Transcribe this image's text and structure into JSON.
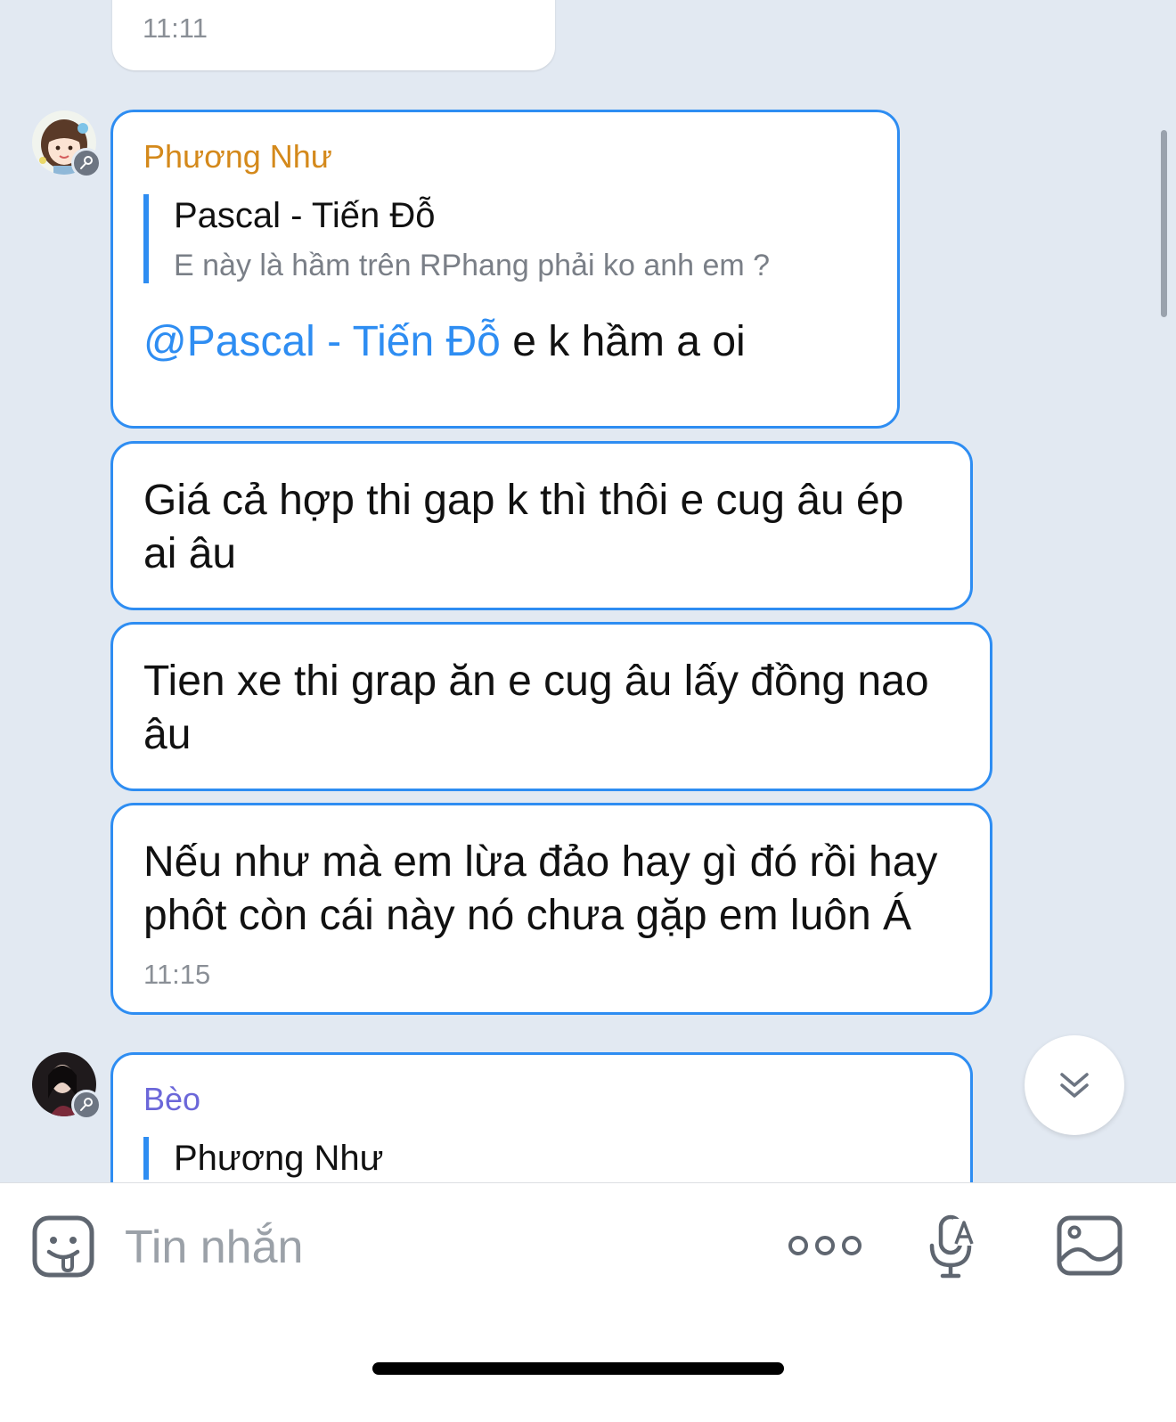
{
  "messages": {
    "prev_time": "11:11",
    "group1": {
      "sender": "Phương Như",
      "sender_color": "#d4891b",
      "reply": {
        "quoted_name": "Pascal - Tiến Đỗ",
        "quoted_text": "E này là hầm trên RPhang phải ko anh em ?",
        "mention": "@Pascal - Tiến Đỗ",
        "text": " e k hầm a oi"
      },
      "msg2": "Giá cả hợp thi gap k thì thôi e cug âu ép ai âu",
      "msg3": "Tien xe thi grap ăn e cug âu lấy đồng nao âu",
      "msg4": "Nếu như mà em lừa đảo hay gì đó rồi hay phôt còn cái này nó chưa gặp em luôn Á",
      "time": "11:15"
    },
    "group2": {
      "sender": "Bèo",
      "sender_color": "#6b67d9",
      "quoted_name": "Phương Như"
    }
  },
  "composer": {
    "placeholder": "Tin nhắn",
    "icons": [
      "sticker-icon",
      "more-icon",
      "voice-to-text-icon",
      "image-icon"
    ]
  },
  "accent_color": "#2e8df2"
}
